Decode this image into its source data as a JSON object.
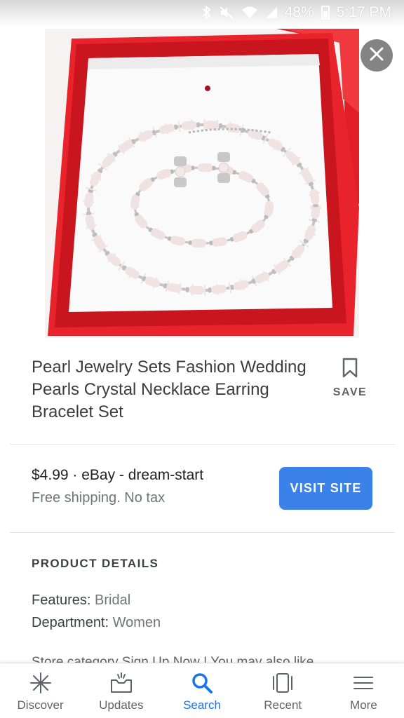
{
  "status_bar": {
    "battery": "48%",
    "time": "5:17 PM"
  },
  "product": {
    "title": "Pearl Jewelry Sets Fashion Wedding Pearls Crystal Necklace Earring Bracelet Set",
    "save_label": "SAVE",
    "price_line": "$4.99 · eBay - dream-start",
    "shipping": "Free shipping. No tax",
    "visit_label": "VISIT SITE"
  },
  "details": {
    "heading": "PRODUCT DETAILS",
    "features_label": "Features:",
    "features_value": "Bridal",
    "department_label": "Department:",
    "department_value": "Women",
    "store_text": "Store category Sign Up Now ! You may also like"
  },
  "nav": {
    "items": [
      {
        "label": "Discover",
        "icon": "asterisk-icon"
      },
      {
        "label": "Updates",
        "icon": "inbox-icon"
      },
      {
        "label": "Search",
        "icon": "search-icon",
        "active": true
      },
      {
        "label": "Recent",
        "icon": "recent-icon"
      },
      {
        "label": "More",
        "icon": "menu-icon"
      }
    ]
  },
  "colors": {
    "accent": "#1a73e8",
    "visit_button": "#3b82e8",
    "box_red": "#e8232c"
  }
}
